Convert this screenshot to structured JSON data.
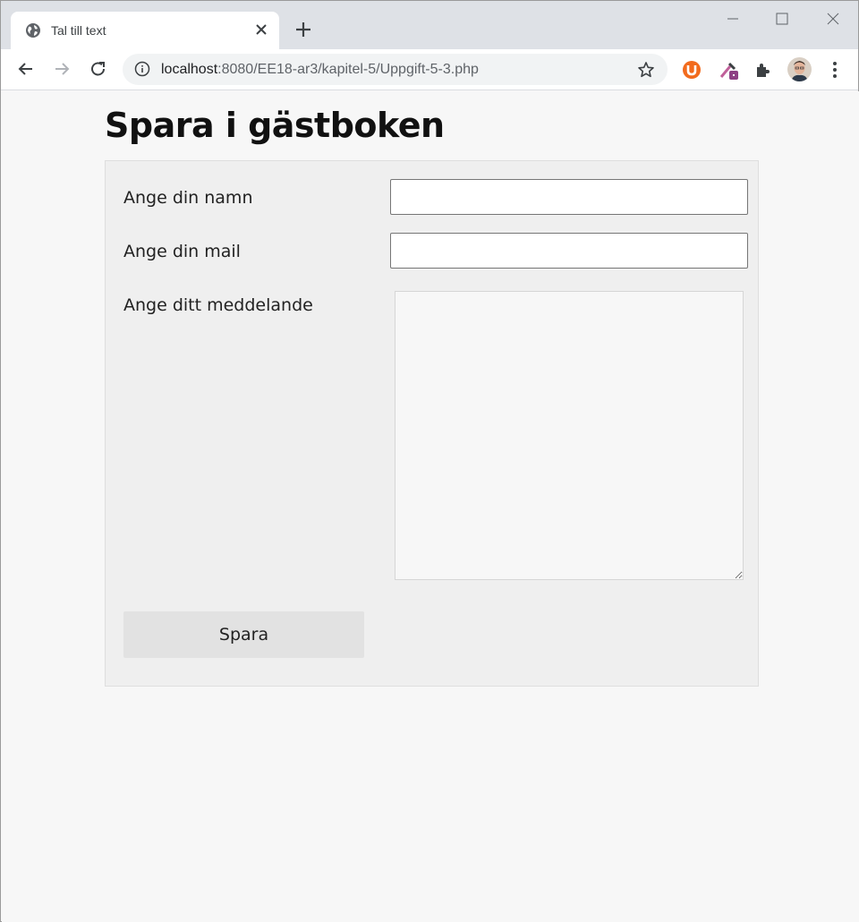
{
  "browser": {
    "tab_title": "Tal till text",
    "url_host": "localhost",
    "url_rest": ":8080/EE18-ar3/kapitel-5/Uppgift-5-3.php",
    "accent": "#1a73e8",
    "extension_u_color": "#f26b1d"
  },
  "page": {
    "title": "Spara i gästboken",
    "form": {
      "name_label": "Ange din namn",
      "name_value": "",
      "mail_label": "Ange din mail",
      "mail_value": "",
      "message_label": "Ange ditt meddelande",
      "message_value": "",
      "submit_label": "Spara"
    }
  }
}
